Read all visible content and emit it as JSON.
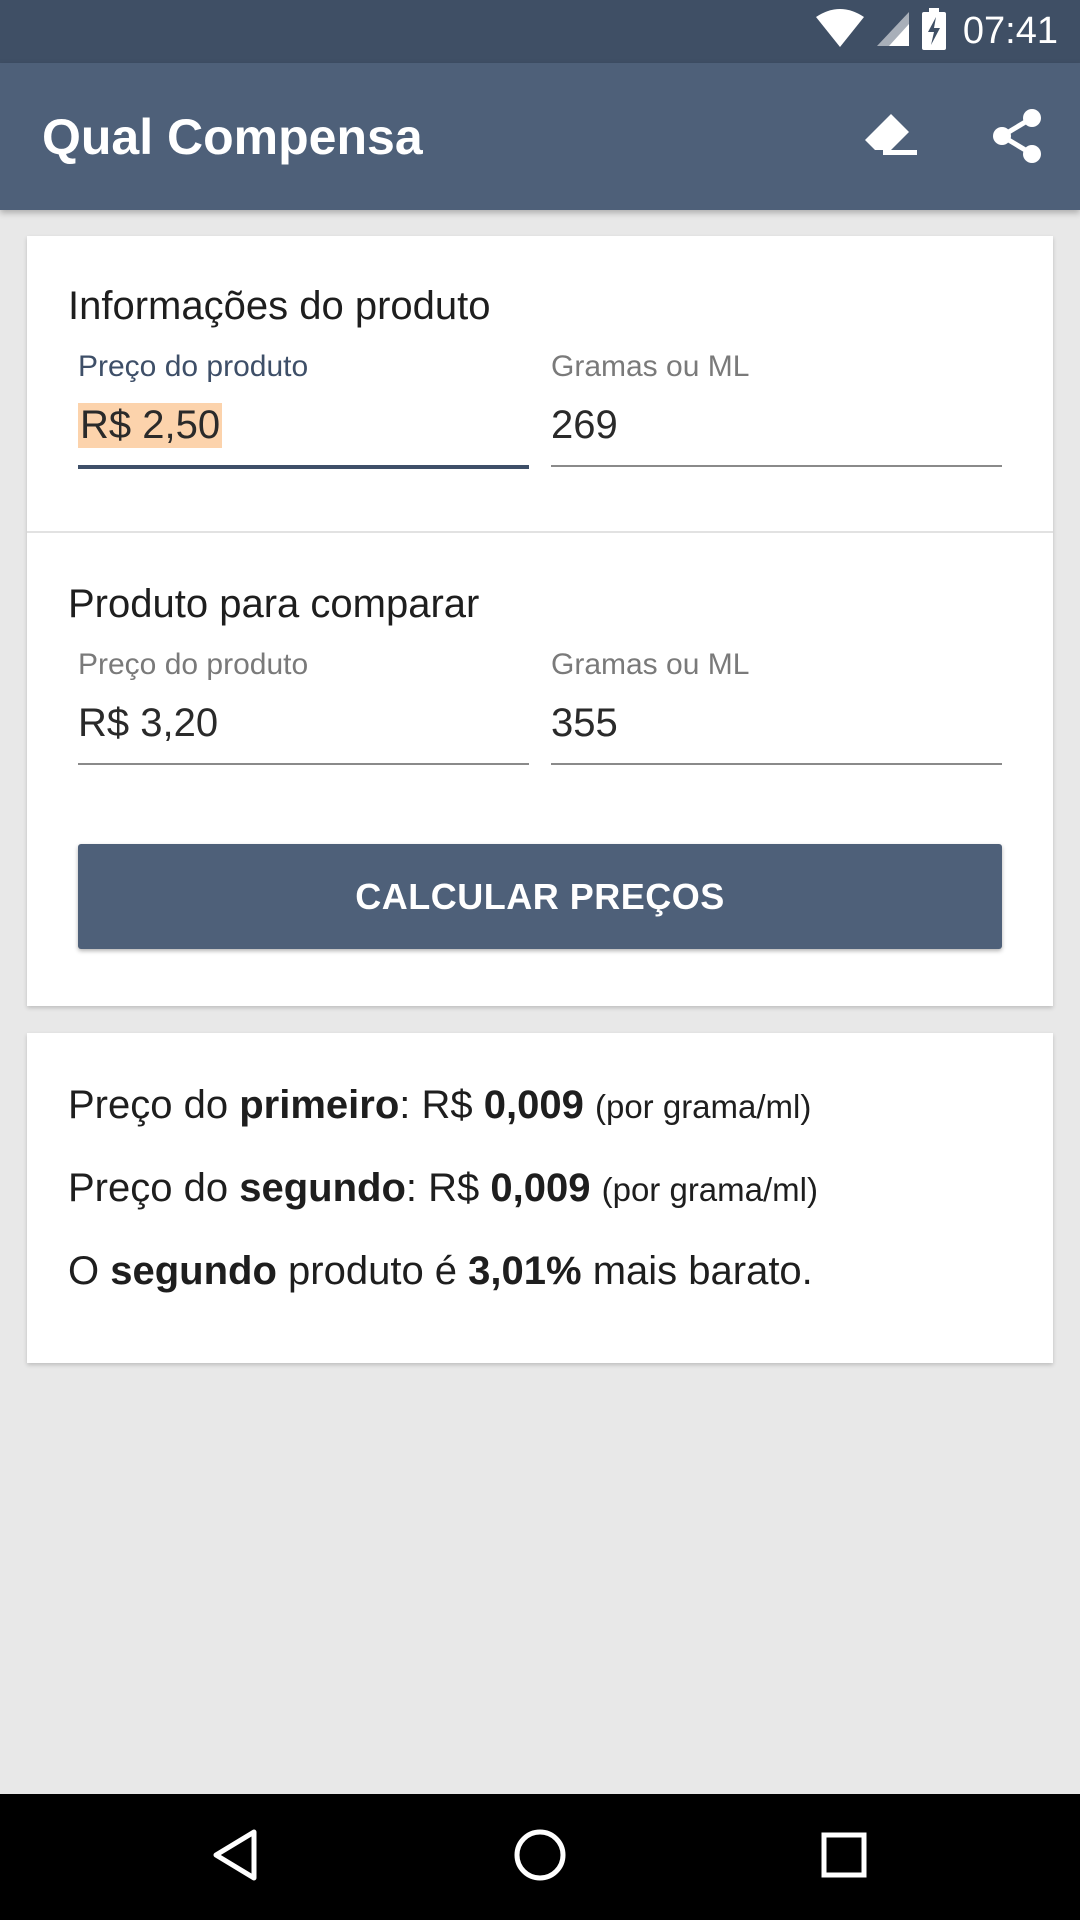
{
  "status_bar": {
    "time": "07:41",
    "icons": [
      "wifi-icon",
      "signal-icon",
      "battery-charging-icon"
    ]
  },
  "app_bar": {
    "title": "Qual Compensa",
    "actions": [
      "eraser-icon",
      "share-icon"
    ]
  },
  "form": {
    "first": {
      "section_title": "Informações do produto",
      "price_label": "Preço do produto",
      "price_value": "R$ 2,50",
      "amount_label": "Gramas ou ML",
      "amount_value": "269"
    },
    "second": {
      "section_title": "Produto para comparar",
      "price_label": "Preço do produto",
      "price_value": "R$ 3,20",
      "amount_label": "Gramas ou ML",
      "amount_value": "355"
    },
    "calc_button_label": "CALCULAR PREÇOS"
  },
  "result": {
    "line1": {
      "prefix": "Preço do ",
      "ordinal": "primeiro",
      "middle": ": R$ ",
      "value": "0,009",
      "suffix": "(por grama/ml)"
    },
    "line2": {
      "prefix": "Preço do ",
      "ordinal": "segundo",
      "middle": ": R$ ",
      "value": "0,009",
      "suffix": "(por grama/ml)"
    },
    "line3": {
      "prefix": "O ",
      "ordinal": "segundo",
      "middle": " produto é ",
      "value": "3,01%",
      "suffix": " mais barato."
    }
  },
  "nav_bar": {
    "buttons": [
      "back-icon",
      "home-icon",
      "recents-icon"
    ]
  },
  "colors": {
    "status_bar": "#3f4f65",
    "app_bar": "#4e6079",
    "accent": "#3e4f68",
    "selection": "#fcd3ac",
    "background": "#e8e8e8"
  }
}
